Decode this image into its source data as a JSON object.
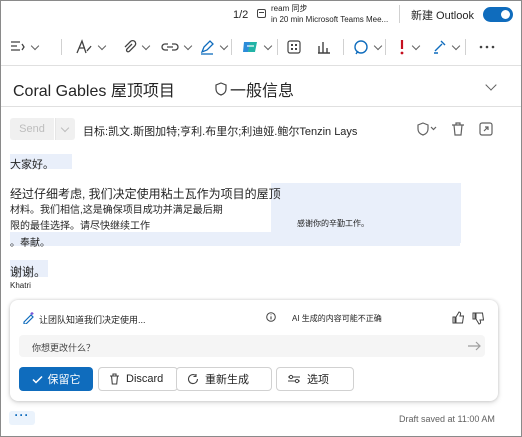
{
  "topbar": {
    "pager": "1/2",
    "notification_title": "ream 同步",
    "notification_sub": "in 20 min Microsoft Teams Mee...",
    "new_outlook_label": "新建 Outlook",
    "new_outlook_on": true
  },
  "toolbar": {
    "icons": [
      "format-paint-icon",
      "text-format-icon",
      "attach-icon",
      "link-icon",
      "draw-icon",
      "copilot-icon",
      "apps-icon",
      "chart-icon",
      "loop-icon",
      "importance-icon",
      "sensitivity-icon",
      "more-icon"
    ]
  },
  "compose": {
    "subject": "Coral Gables 屋顶项目",
    "sensitivity": "一般信息",
    "send_label": "Send",
    "to_line": "目标:凯文.斯图加特;亨利.布里尔;利迪娅.鲍尔Tenzin Lays"
  },
  "body": {
    "greeting": "大家好。",
    "p1_line1": "经过仔细考虑, 我们决定使用粘土瓦作为项目的屋顶",
    "p1_line2": "材料。我们相信,这是确保项目成功并满足最后期",
    "p1_line3": "限的最佳选择。请尽快继续工作",
    "p1_line3_right": "感谢你的辛勤工作。",
    "p1_line4": "。奉献。",
    "closing": "谢谢。",
    "signature": "Khatri"
  },
  "copilot": {
    "title": "让团队知道我们决定使用...",
    "disclaimer": "AI 生成的内容可能不正确",
    "input_placeholder": "你想更改什么？",
    "keep_label": "保留它",
    "discard_label": "Discard",
    "regenerate_label": "重新生成",
    "options_label": "选项"
  },
  "footer": {
    "more_label": "···",
    "draft_status": "Draft saved at 11:00 AM"
  },
  "colors": {
    "accent": "#0f6cbd",
    "highlight": "#e9effa"
  }
}
